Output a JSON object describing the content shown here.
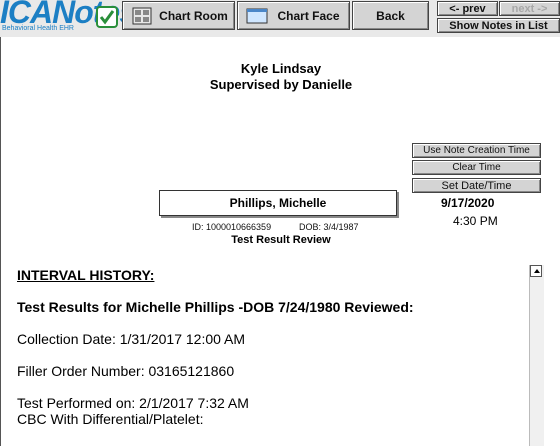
{
  "logo": {
    "text": "ICANotes",
    "tagline": "Behavioral Health EHR"
  },
  "toolbar": {
    "chart_room": "Chart Room",
    "chart_face": "Chart Face",
    "back": "Back",
    "prev": "<- prev",
    "next": "next ->",
    "show_notes": "Show Notes in List"
  },
  "header": {
    "provider": "Kyle Lindsay",
    "supervised": "Supervised by Danielle"
  },
  "time_controls": {
    "use_creation_time": "Use Note Creation Time",
    "clear_time": "Clear Time",
    "set_datetime": "Set Date/Time",
    "date": "9/17/2020",
    "time": "4:30 PM"
  },
  "client": {
    "name": "Phillips, Michelle",
    "id": "ID: 1000010666359",
    "dob": "DOB: 3/4/1987",
    "note_type": "Test Result Review"
  },
  "note": {
    "section_heading": "INTERVAL HISTORY:",
    "results_heading": "Test Results for Michelle Phillips -DOB 7/24/1980 Reviewed:",
    "collection_date": "Collection Date: 1/31/2017 12:00 AM",
    "filler_order": "Filler Order Number: 03165121860",
    "test_performed": "Test Performed on: 2/1/2017 7:32 AM",
    "test_name": "CBC With Differential/Platelet:"
  },
  "colors": {
    "brand": "#1c7fc4",
    "button_face": "#d4d4d4",
    "background": "#e9e9e9"
  }
}
